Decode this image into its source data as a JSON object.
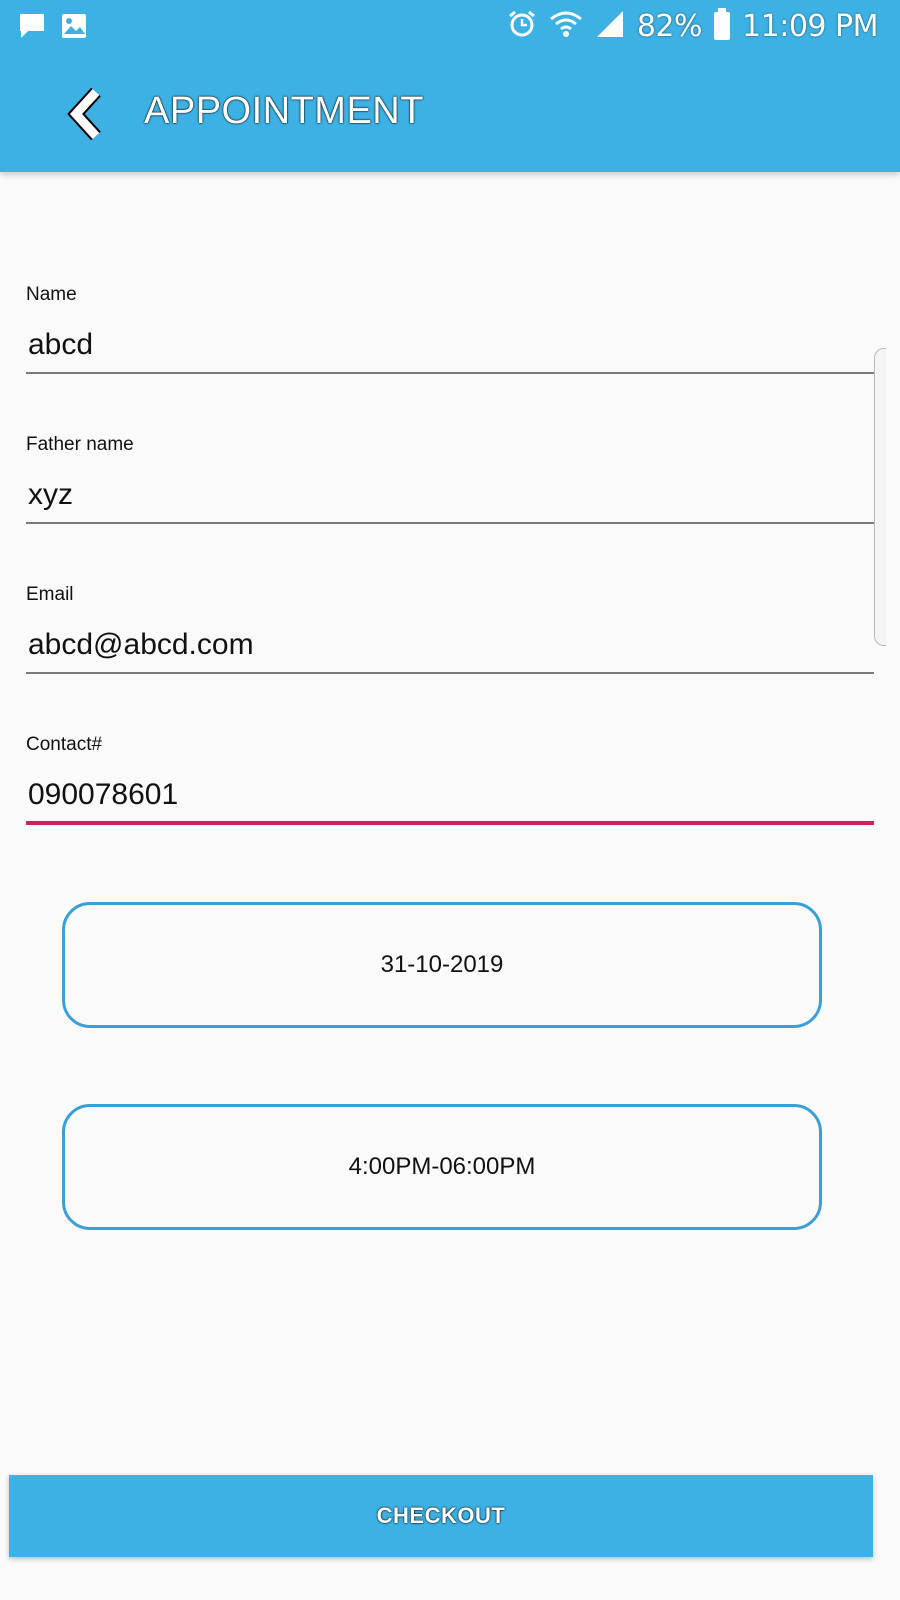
{
  "status_bar": {
    "icons_left": [
      "chat-icon",
      "image-icon"
    ],
    "icons_right": [
      "alarm-icon",
      "wifi-icon",
      "signal-icon",
      "battery-icon"
    ],
    "battery": "82%",
    "time": "11:09 PM"
  },
  "header": {
    "title": "APPOINTMENT",
    "back_icon": "chevron-left-icon"
  },
  "form": {
    "name": {
      "label": "Name",
      "value": "abcd"
    },
    "father_name": {
      "label": "Father name",
      "value": "xyz"
    },
    "email": {
      "label": "Email",
      "value": "abcd@abcd.com"
    },
    "contact": {
      "label": "Contact#",
      "value": "090078601"
    }
  },
  "selectors": {
    "date": "31-10-2019",
    "time_slot": "4:00PM-06:00PM"
  },
  "checkout": {
    "label": "CHECKOUT"
  },
  "colors": {
    "primary": "#3db1e3",
    "border": "#3a9fd8",
    "focus_underline": "#d81b60",
    "background": "#fafafa"
  }
}
